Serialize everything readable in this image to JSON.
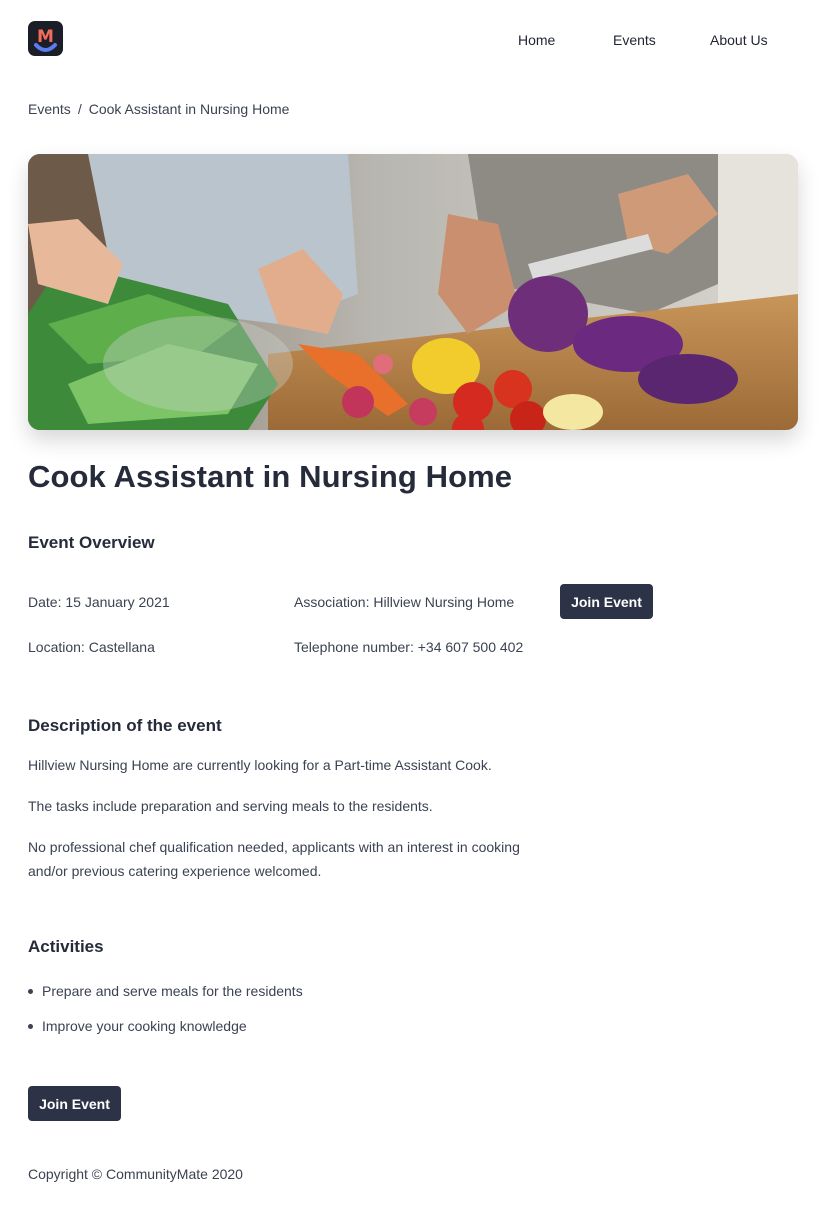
{
  "header": {
    "logo_letter": "M",
    "nav": {
      "home": "Home",
      "events": "Events",
      "about": "About Us"
    }
  },
  "breadcrumb": {
    "root": "Events",
    "separator": "/",
    "current": "Cook Assistant in Nursing Home"
  },
  "event": {
    "title": "Cook Assistant in Nursing Home",
    "overview_heading": "Event Overview",
    "date": "Date: 15 January 2021",
    "association": "Association: Hillview Nursing Home",
    "location": "Location: Castellana",
    "telephone": "Telephone number: +34 607 500 402",
    "join_label": "Join Event"
  },
  "description": {
    "heading": "Description of the event",
    "paragraphs": [
      "Hillview Nursing Home are currently looking for a Part-time Assistant Cook.",
      "The tasks include preparation and serving meals to the residents.",
      "No professional chef qualification needed, applicants with an interest in cooking and/or previous catering experience welcomed."
    ]
  },
  "activities": {
    "heading": "Activities",
    "items": [
      "Prepare and serve meals for the residents",
      "Improve your cooking knowledge"
    ]
  },
  "footer": {
    "copyright": "Copyright © CommunityMate 2020"
  },
  "colors": {
    "button_bg": "#2d3347",
    "heading": "#252b3a",
    "text": "#3b4252"
  }
}
